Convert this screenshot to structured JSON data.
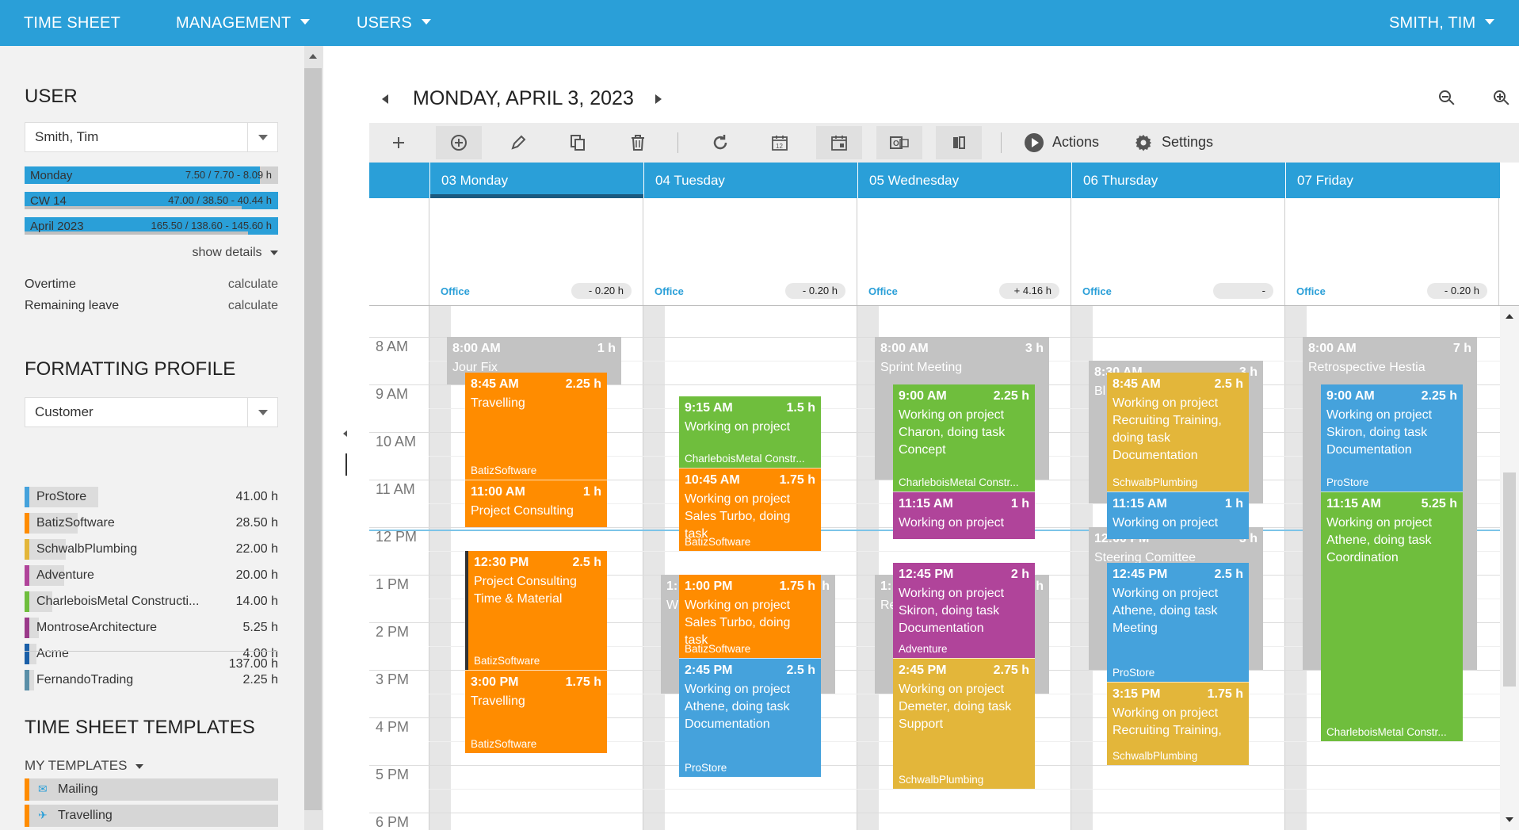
{
  "topnav": {
    "timesheet": "TIME SHEET",
    "management": "MANAGEMENT",
    "users": "USERS",
    "current_user": "SMITH, TIM"
  },
  "user_section": {
    "title": "USER",
    "selected_user": "Smith, Tim",
    "summary": [
      {
        "label": "Monday",
        "value": "7.50 / 7.70 - 8.09 h",
        "progress": 0.93
      },
      {
        "label": "CW 14",
        "value": "47.00 / 38.50 - 40.44 h",
        "progress": 1.0
      },
      {
        "label": "April 2023",
        "value": "165.50 / 138.60 - 145.60 h",
        "progress": 1.0
      }
    ],
    "show_details": "show details",
    "overtime_label": "Overtime",
    "overtime_value": "calculate",
    "leave_label": "Remaining leave",
    "leave_value": "calculate"
  },
  "formatting_section": {
    "title": "FORMATTING PROFILE",
    "selected_profile": "Customer",
    "customers": [
      {
        "name": "ProStore",
        "hours": "41.00 h",
        "color": "#45a2dc",
        "share": 0.3
      },
      {
        "name": "BatizSoftware",
        "hours": "28.50 h",
        "color": "#ff8c00",
        "share": 0.21
      },
      {
        "name": "SchwalbPlumbing",
        "hours": "22.00 h",
        "color": "#e3b63a",
        "share": 0.16
      },
      {
        "name": "Adventure",
        "hours": "20.00 h",
        "color": "#b0449a",
        "share": 0.15
      },
      {
        "name": "CharleboisMetal Constructi...",
        "hours": "14.00 h",
        "color": "#6fbe3d",
        "share": 0.1
      },
      {
        "name": "MontroseArchitecture",
        "hours": "5.25 h",
        "color": "#9a3a8a",
        "share": 0.04
      },
      {
        "name": "Acme",
        "hours": "4.00 h",
        "color": "#1a5fa8",
        "share": 0.03
      },
      {
        "name": "FernandoTrading",
        "hours": "2.25 h",
        "color": "#5a8fa8",
        "share": 0.02
      }
    ],
    "total": "137.00 h"
  },
  "templates_section": {
    "title": "TIME SHEET TEMPLATES",
    "my_templates": "MY TEMPLATES",
    "items": [
      {
        "name": "Mailing",
        "icon": "mail-icon"
      },
      {
        "name": "Travelling",
        "icon": "airplane-icon"
      }
    ]
  },
  "calendar": {
    "date_title": "MONDAY, APRIL 3, 2023",
    "toolbar": {
      "actions": "Actions",
      "settings": "Settings"
    },
    "days": [
      {
        "header": "03 Monday",
        "location": "Office",
        "balance": "- 0.20 h"
      },
      {
        "header": "04 Tuesday",
        "location": "Office",
        "balance": "- 0.20 h"
      },
      {
        "header": "05 Wednesday",
        "location": "Office",
        "balance": "+ 4.16 h"
      },
      {
        "header": "06 Thursday",
        "location": "Office",
        "balance": "-"
      },
      {
        "header": "07 Friday",
        "location": "Office",
        "balance": "- 0.20 h"
      }
    ],
    "hours": [
      "8 AM",
      "9 AM",
      "10 AM",
      "11 AM",
      "12 PM",
      "1 PM",
      "2 PM",
      "3 PM",
      "4 PM",
      "5 PM",
      "6 PM"
    ],
    "events": {
      "mon": [
        {
          "time": "8:00 AM",
          "duration": "1 h",
          "desc": "Jour Fix",
          "client": "",
          "color": "grey"
        },
        {
          "time": "8:45 AM",
          "duration": "2.25 h",
          "desc": "Travelling",
          "client": "BatizSoftware",
          "color": "orange"
        },
        {
          "time": "11:00 AM",
          "duration": "1 h",
          "desc": "Project Consulting",
          "client": "",
          "color": "orange"
        },
        {
          "time": "12:30 PM",
          "duration": "2.5 h",
          "desc": "Project Consulting Time & Material",
          "client": "BatizSoftware",
          "color": "orange"
        },
        {
          "time": "3:00 PM",
          "duration": "1.75 h",
          "desc": "Travelling",
          "client": "BatizSoftware",
          "color": "orange"
        }
      ],
      "tue": [
        {
          "time": "1:",
          "duration": "h",
          "desc": "W",
          "client": "",
          "color": "grey"
        },
        {
          "time": "9:15 AM",
          "duration": "1.5 h",
          "desc": "Working on project",
          "client": "CharleboisMetal Constr...",
          "color": "green"
        },
        {
          "time": "10:45 AM",
          "duration": "1.75 h",
          "desc": "Working on project Sales Turbo, doing task",
          "client": "BatizSoftware",
          "color": "orange"
        },
        {
          "time": "1:00 PM",
          "duration": "1.75 h",
          "desc": "Working on project Sales Turbo, doing task",
          "client": "BatizSoftware",
          "color": "orange"
        },
        {
          "time": "2:45 PM",
          "duration": "2.5 h",
          "desc": "Working on project Athene, doing task Documentation",
          "client": "ProStore",
          "color": "blue"
        }
      ],
      "wed": [
        {
          "time": "8:00 AM",
          "duration": "3 h",
          "desc": "Sprint Meeting",
          "client": "",
          "color": "grey"
        },
        {
          "time": "1:",
          "duration": "h",
          "desc": "Re",
          "client": "",
          "color": "grey"
        },
        {
          "time": "9:00 AM",
          "duration": "2.25 h",
          "desc": "Working on project Charon, doing task Concept",
          "client": "CharleboisMetal Constr...",
          "color": "green"
        },
        {
          "time": "11:15 AM",
          "duration": "1 h",
          "desc": "Working on project",
          "client": "",
          "color": "purple"
        },
        {
          "time": "12:45 PM",
          "duration": "2 h",
          "desc": "Working on project Skiron, doing task Documentation",
          "client": "Adventure",
          "color": "purple"
        },
        {
          "time": "2:45 PM",
          "duration": "2.75 h",
          "desc": "Working on project Demeter, doing task Support",
          "client": "SchwalbPlumbing",
          "color": "yellow"
        }
      ],
      "thu": [
        {
          "time": "8:30 AM",
          "duration": "3 h",
          "desc": "Bl",
          "client": "",
          "color": "grey"
        },
        {
          "time": "12:00 PM",
          "duration": "3 h",
          "desc": "Steering Comittee",
          "client": "",
          "color": "grey"
        },
        {
          "time": "8:45 AM",
          "duration": "2.5 h",
          "desc": "Working on project Recruiting Training, doing task Documentation",
          "client": "SchwalbPlumbing",
          "color": "yellow"
        },
        {
          "time": "11:15 AM",
          "duration": "1 h",
          "desc": "Working on project",
          "client": "",
          "color": "blue"
        },
        {
          "time": "12:45 PM",
          "duration": "2.5 h",
          "desc": "Working on project Athene, doing task Meeting",
          "client": "ProStore",
          "color": "blue"
        },
        {
          "time": "3:15 PM",
          "duration": "1.75 h",
          "desc": "Working on project Recruiting Training,",
          "client": "SchwalbPlumbing",
          "color": "yellow"
        }
      ],
      "fri": [
        {
          "time": "8:00 AM",
          "duration": "7 h",
          "desc": "Retrospective Hestia",
          "client": "",
          "color": "grey"
        },
        {
          "time": "9:00 AM",
          "duration": "2.25 h",
          "desc": "Working on project Skiron, doing task Documentation",
          "client": "ProStore",
          "color": "blue"
        },
        {
          "time": "11:15 AM",
          "duration": "5.25 h",
          "desc": "Working on project Athene, doing task Coordination",
          "client": "CharleboisMetal Constr...",
          "color": "green"
        }
      ]
    }
  }
}
